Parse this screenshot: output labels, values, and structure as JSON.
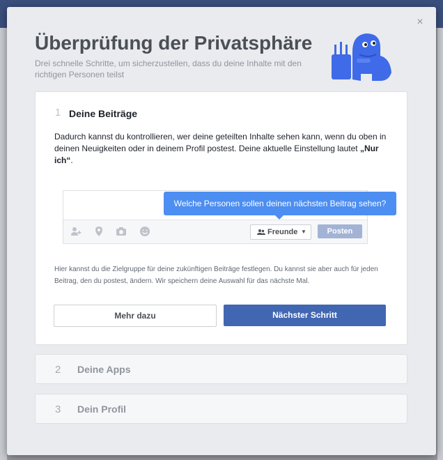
{
  "modal": {
    "title": "Überprüfung der Privatsphäre",
    "subtitle": "Drei schnelle Schritte, um sicherzustellen, dass du deine Inhalte mit den richtigen Personen teilst",
    "close_icon": "×"
  },
  "step1": {
    "number": "1",
    "title": "Deine Beiträge",
    "description_before": "Dadurch kannst du kontrollieren, wer deine geteilten Inhalte sehen kann, wenn du oben in deinen Neuigkeiten oder in deinem Profil postest. Deine aktuelle Einstellung lautet ",
    "current_setting": "„Nur ich“",
    "description_after": ".",
    "tooltip": "Welche Personen sollen deinen nächsten Beitrag sehen?",
    "audience_label": "Freunde",
    "post_label": "Posten",
    "hint": "Hier kannst du die Zielgruppe für deine zukünftigen Beiträge festlegen. Du kannst sie aber auch für jeden Beitrag, den du postest, ändern. Wir speichern deine Auswahl für das nächste Mal.",
    "more_button": "Mehr dazu",
    "next_button": "Nächster Schritt"
  },
  "step2": {
    "number": "2",
    "title": "Deine Apps"
  },
  "step3": {
    "number": "3",
    "title": "Dein Profil"
  },
  "icons": {
    "close": "close-icon",
    "tag_friends": "add-friend-icon",
    "location": "location-pin-icon",
    "camera": "camera-icon",
    "emoji": "smiley-icon",
    "audience": "friends-icon",
    "chevron": "chevron-down-icon",
    "mascot": "privacy-dinosaur-icon"
  },
  "colors": {
    "primary": "#4267b2",
    "tooltip": "#4c8ef1",
    "mascot": "#3f6ae8"
  }
}
